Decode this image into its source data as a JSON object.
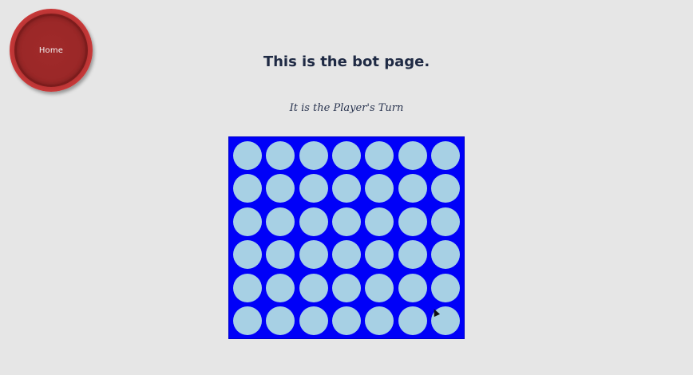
{
  "home": {
    "label": "Home"
  },
  "page": {
    "title": "This is the bot page.",
    "status": "It is the Player's Turn"
  },
  "board": {
    "rows": 6,
    "columns": 7,
    "board_color": "#0000f8",
    "empty_cell_color": "#a7d0e4",
    "cells": [
      [
        "empty",
        "empty",
        "empty",
        "empty",
        "empty",
        "empty",
        "empty"
      ],
      [
        "empty",
        "empty",
        "empty",
        "empty",
        "empty",
        "empty",
        "empty"
      ],
      [
        "empty",
        "empty",
        "empty",
        "empty",
        "empty",
        "empty",
        "empty"
      ],
      [
        "empty",
        "empty",
        "empty",
        "empty",
        "empty",
        "empty",
        "empty"
      ],
      [
        "empty",
        "empty",
        "empty",
        "empty",
        "empty",
        "empty",
        "empty"
      ],
      [
        "empty",
        "empty",
        "empty",
        "empty",
        "empty",
        "empty",
        "empty"
      ]
    ]
  },
  "colors": {
    "background": "#e6e6e6",
    "home_button": "#a02a2a",
    "title_text": "#1f2a44"
  }
}
